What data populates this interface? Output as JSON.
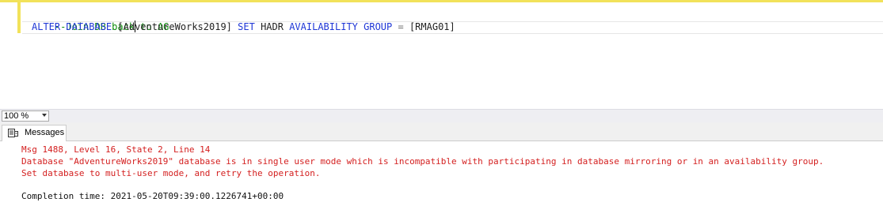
{
  "editor": {
    "comment_line": "--Join DB back to AG",
    "statement": {
      "kw_alter_database": "ALTER DATABASE",
      "db_name_before_caret": "[Ad",
      "db_name_after_caret": "ventureWorks2019]",
      "kw_set": "SET",
      "hadr": "HADR",
      "kw_availability_group": "AVAILABILITY GROUP",
      "operator": "=",
      "ag_name": "[RMAG01]"
    }
  },
  "zoom": {
    "value": "100 %"
  },
  "results_tabs": {
    "messages_label": "Messages",
    "messages_icon": "messages-icon"
  },
  "messages": {
    "error_header": "Msg 1488, Level 16, State 2, Line 14",
    "error_body_1": "Database \"AdventureWorks2019\" database is in single user mode which is incompatible with participating in database mirroring or in an availability group.",
    "error_body_2": "Set database to multi-user mode, and retry the operation.",
    "completion": "Completion time: 2021-05-20T09:39:00.1226741+00:00"
  },
  "colors": {
    "comment": "#0a8a0a",
    "keyword": "#1f37d6",
    "error": "#d42020",
    "change_bar": "#f2e25a"
  }
}
